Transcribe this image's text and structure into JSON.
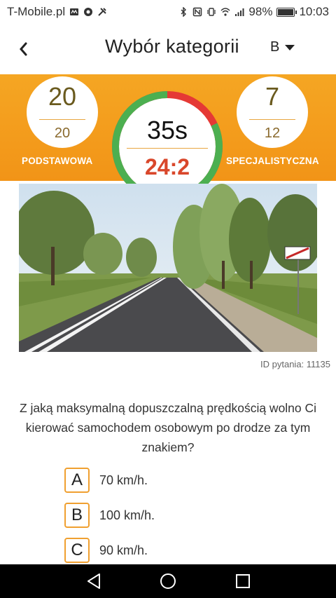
{
  "status_bar": {
    "carrier": "T-Mobile.pl",
    "battery": "98%",
    "battery_level": 0.98,
    "time": "10:03",
    "icons_left": [
      "drive-mode-icon",
      "chrome-icon",
      "tools-icon"
    ],
    "icons_right": [
      "bluetooth-icon",
      "nfc-icon",
      "vibrate-icon",
      "wifi-icon",
      "signal-icon",
      "battery-icon"
    ]
  },
  "header": {
    "title": "Wybór kategorii",
    "category": "B"
  },
  "scores": {
    "basic": {
      "value": "20",
      "total": "20",
      "label": "PODSTAWOWA"
    },
    "specialist": {
      "value": "7",
      "total": "12",
      "label": "SPECJALISTYCZNA"
    },
    "timer": {
      "seconds": "35s",
      "ratio": "24:2",
      "progress": 0.82
    }
  },
  "question": {
    "id_text": "ID pytania: 11135",
    "text": "Z jaką maksymalną dopuszczalną prędkością wolno Ci kierować samochodem osobowym po drodze za tym znakiem?",
    "answers": [
      {
        "letter": "A",
        "text": "70 km/h."
      },
      {
        "letter": "B",
        "text": "100 km/h."
      },
      {
        "letter": "C",
        "text": "90 km/h."
      }
    ]
  },
  "colors": {
    "accent": "#f29417",
    "timer_green": "#4caf50",
    "timer_red": "#e53935",
    "ratio_text": "#d9472b"
  }
}
